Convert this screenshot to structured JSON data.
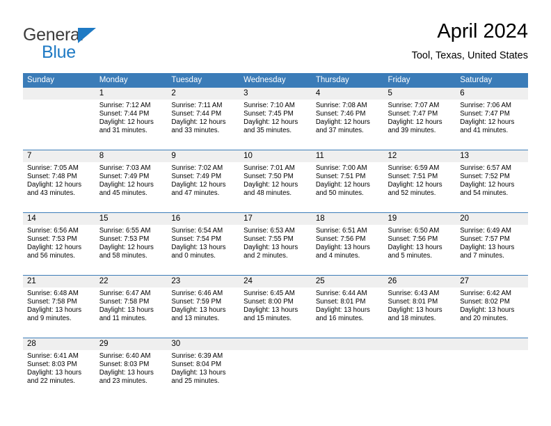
{
  "brand": {
    "name_part1": "General",
    "name_part2": "Blue",
    "accent_color": "#1f7ac4",
    "triangle_icon": "triangle-logo-icon"
  },
  "header": {
    "title": "April 2024",
    "location": "Tool, Texas, United States"
  },
  "calendar": {
    "header_bg": "#3b7cb8",
    "date_band_bg": "#efefef",
    "weekdays": [
      "Sunday",
      "Monday",
      "Tuesday",
      "Wednesday",
      "Thursday",
      "Friday",
      "Saturday"
    ],
    "weeks": [
      [
        {
          "day": "",
          "sunrise": "",
          "sunset": "",
          "daylight_1": "",
          "daylight_2": ""
        },
        {
          "day": "1",
          "sunrise": "Sunrise: 7:12 AM",
          "sunset": "Sunset: 7:44 PM",
          "daylight_1": "Daylight: 12 hours",
          "daylight_2": "and 31 minutes."
        },
        {
          "day": "2",
          "sunrise": "Sunrise: 7:11 AM",
          "sunset": "Sunset: 7:44 PM",
          "daylight_1": "Daylight: 12 hours",
          "daylight_2": "and 33 minutes."
        },
        {
          "day": "3",
          "sunrise": "Sunrise: 7:10 AM",
          "sunset": "Sunset: 7:45 PM",
          "daylight_1": "Daylight: 12 hours",
          "daylight_2": "and 35 minutes."
        },
        {
          "day": "4",
          "sunrise": "Sunrise: 7:08 AM",
          "sunset": "Sunset: 7:46 PM",
          "daylight_1": "Daylight: 12 hours",
          "daylight_2": "and 37 minutes."
        },
        {
          "day": "5",
          "sunrise": "Sunrise: 7:07 AM",
          "sunset": "Sunset: 7:47 PM",
          "daylight_1": "Daylight: 12 hours",
          "daylight_2": "and 39 minutes."
        },
        {
          "day": "6",
          "sunrise": "Sunrise: 7:06 AM",
          "sunset": "Sunset: 7:47 PM",
          "daylight_1": "Daylight: 12 hours",
          "daylight_2": "and 41 minutes."
        }
      ],
      [
        {
          "day": "7",
          "sunrise": "Sunrise: 7:05 AM",
          "sunset": "Sunset: 7:48 PM",
          "daylight_1": "Daylight: 12 hours",
          "daylight_2": "and 43 minutes."
        },
        {
          "day": "8",
          "sunrise": "Sunrise: 7:03 AM",
          "sunset": "Sunset: 7:49 PM",
          "daylight_1": "Daylight: 12 hours",
          "daylight_2": "and 45 minutes."
        },
        {
          "day": "9",
          "sunrise": "Sunrise: 7:02 AM",
          "sunset": "Sunset: 7:49 PM",
          "daylight_1": "Daylight: 12 hours",
          "daylight_2": "and 47 minutes."
        },
        {
          "day": "10",
          "sunrise": "Sunrise: 7:01 AM",
          "sunset": "Sunset: 7:50 PM",
          "daylight_1": "Daylight: 12 hours",
          "daylight_2": "and 48 minutes."
        },
        {
          "day": "11",
          "sunrise": "Sunrise: 7:00 AM",
          "sunset": "Sunset: 7:51 PM",
          "daylight_1": "Daylight: 12 hours",
          "daylight_2": "and 50 minutes."
        },
        {
          "day": "12",
          "sunrise": "Sunrise: 6:59 AM",
          "sunset": "Sunset: 7:51 PM",
          "daylight_1": "Daylight: 12 hours",
          "daylight_2": "and 52 minutes."
        },
        {
          "day": "13",
          "sunrise": "Sunrise: 6:57 AM",
          "sunset": "Sunset: 7:52 PM",
          "daylight_1": "Daylight: 12 hours",
          "daylight_2": "and 54 minutes."
        }
      ],
      [
        {
          "day": "14",
          "sunrise": "Sunrise: 6:56 AM",
          "sunset": "Sunset: 7:53 PM",
          "daylight_1": "Daylight: 12 hours",
          "daylight_2": "and 56 minutes."
        },
        {
          "day": "15",
          "sunrise": "Sunrise: 6:55 AM",
          "sunset": "Sunset: 7:53 PM",
          "daylight_1": "Daylight: 12 hours",
          "daylight_2": "and 58 minutes."
        },
        {
          "day": "16",
          "sunrise": "Sunrise: 6:54 AM",
          "sunset": "Sunset: 7:54 PM",
          "daylight_1": "Daylight: 13 hours",
          "daylight_2": "and 0 minutes."
        },
        {
          "day": "17",
          "sunrise": "Sunrise: 6:53 AM",
          "sunset": "Sunset: 7:55 PM",
          "daylight_1": "Daylight: 13 hours",
          "daylight_2": "and 2 minutes."
        },
        {
          "day": "18",
          "sunrise": "Sunrise: 6:51 AM",
          "sunset": "Sunset: 7:56 PM",
          "daylight_1": "Daylight: 13 hours",
          "daylight_2": "and 4 minutes."
        },
        {
          "day": "19",
          "sunrise": "Sunrise: 6:50 AM",
          "sunset": "Sunset: 7:56 PM",
          "daylight_1": "Daylight: 13 hours",
          "daylight_2": "and 5 minutes."
        },
        {
          "day": "20",
          "sunrise": "Sunrise: 6:49 AM",
          "sunset": "Sunset: 7:57 PM",
          "daylight_1": "Daylight: 13 hours",
          "daylight_2": "and 7 minutes."
        }
      ],
      [
        {
          "day": "21",
          "sunrise": "Sunrise: 6:48 AM",
          "sunset": "Sunset: 7:58 PM",
          "daylight_1": "Daylight: 13 hours",
          "daylight_2": "and 9 minutes."
        },
        {
          "day": "22",
          "sunrise": "Sunrise: 6:47 AM",
          "sunset": "Sunset: 7:58 PM",
          "daylight_1": "Daylight: 13 hours",
          "daylight_2": "and 11 minutes."
        },
        {
          "day": "23",
          "sunrise": "Sunrise: 6:46 AM",
          "sunset": "Sunset: 7:59 PM",
          "daylight_1": "Daylight: 13 hours",
          "daylight_2": "and 13 minutes."
        },
        {
          "day": "24",
          "sunrise": "Sunrise: 6:45 AM",
          "sunset": "Sunset: 8:00 PM",
          "daylight_1": "Daylight: 13 hours",
          "daylight_2": "and 15 minutes."
        },
        {
          "day": "25",
          "sunrise": "Sunrise: 6:44 AM",
          "sunset": "Sunset: 8:01 PM",
          "daylight_1": "Daylight: 13 hours",
          "daylight_2": "and 16 minutes."
        },
        {
          "day": "26",
          "sunrise": "Sunrise: 6:43 AM",
          "sunset": "Sunset: 8:01 PM",
          "daylight_1": "Daylight: 13 hours",
          "daylight_2": "and 18 minutes."
        },
        {
          "day": "27",
          "sunrise": "Sunrise: 6:42 AM",
          "sunset": "Sunset: 8:02 PM",
          "daylight_1": "Daylight: 13 hours",
          "daylight_2": "and 20 minutes."
        }
      ],
      [
        {
          "day": "28",
          "sunrise": "Sunrise: 6:41 AM",
          "sunset": "Sunset: 8:03 PM",
          "daylight_1": "Daylight: 13 hours",
          "daylight_2": "and 22 minutes."
        },
        {
          "day": "29",
          "sunrise": "Sunrise: 6:40 AM",
          "sunset": "Sunset: 8:03 PM",
          "daylight_1": "Daylight: 13 hours",
          "daylight_2": "and 23 minutes."
        },
        {
          "day": "30",
          "sunrise": "Sunrise: 6:39 AM",
          "sunset": "Sunset: 8:04 PM",
          "daylight_1": "Daylight: 13 hours",
          "daylight_2": "and 25 minutes."
        },
        {
          "day": "",
          "sunrise": "",
          "sunset": "",
          "daylight_1": "",
          "daylight_2": ""
        },
        {
          "day": "",
          "sunrise": "",
          "sunset": "",
          "daylight_1": "",
          "daylight_2": ""
        },
        {
          "day": "",
          "sunrise": "",
          "sunset": "",
          "daylight_1": "",
          "daylight_2": ""
        },
        {
          "day": "",
          "sunrise": "",
          "sunset": "",
          "daylight_1": "",
          "daylight_2": ""
        }
      ]
    ]
  }
}
